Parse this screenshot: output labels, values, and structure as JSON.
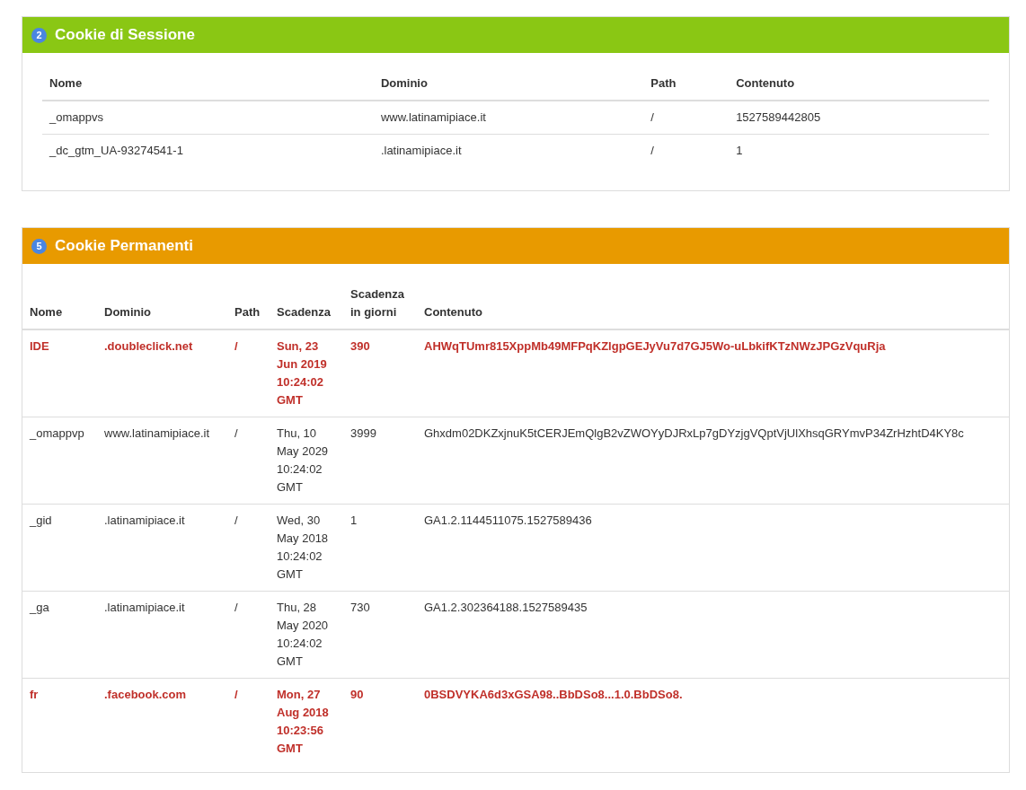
{
  "panels": [
    {
      "kind": "session",
      "badge": "2",
      "title": "Cookie di Sessione",
      "color": "#8ac714",
      "columns": [
        "Nome",
        "Dominio",
        "Path",
        "Contenuto"
      ],
      "rows": [
        {
          "flagged": false,
          "cells": [
            "_omappvs",
            "www.latinamipiace.it",
            "/",
            "1527589442805"
          ]
        },
        {
          "flagged": false,
          "cells": [
            "_dc_gtm_UA-93274541-1",
            ".latinamipiace.it",
            "/",
            "1"
          ]
        }
      ]
    },
    {
      "kind": "permanent",
      "badge": "5",
      "title": "Cookie Permanenti",
      "color": "#e89a00",
      "columns": [
        "Nome",
        "Dominio",
        "Path",
        "Scadenza",
        "Scadenza in giorni",
        "Contenuto"
      ],
      "rows": [
        {
          "flagged": true,
          "cells": [
            "IDE",
            ".doubleclick.net",
            "/",
            "Sun, 23 Jun 2019 10:24:02 GMT",
            "390",
            "AHWqTUmr815XppMb49MFPqKZlgpGEJyVu7d7GJ5Wo-uLbkifKTzNWzJPGzVquRja"
          ]
        },
        {
          "flagged": false,
          "cells": [
            "_omappvp",
            "www.latinamipiace.it",
            "/",
            "Thu, 10 May 2029 10:24:02 GMT",
            "3999",
            "Ghxdm02DKZxjnuK5tCERJEmQlgB2vZWOYyDJRxLp7gDYzjgVQptVjUlXhsqGRYmvP34ZrHzhtD4KY8c"
          ]
        },
        {
          "flagged": false,
          "cells": [
            "_gid",
            ".latinamipiace.it",
            "/",
            "Wed, 30 May 2018 10:24:02 GMT",
            "1",
            "GA1.2.1144511075.1527589436"
          ]
        },
        {
          "flagged": false,
          "cells": [
            "_ga",
            ".latinamipiace.it",
            "/",
            "Thu, 28 May 2020 10:24:02 GMT",
            "730",
            "GA1.2.302364188.1527589435"
          ]
        },
        {
          "flagged": true,
          "cells": [
            "fr",
            ".facebook.com",
            "/",
            "Mon, 27 Aug 2018 10:23:56 GMT",
            "90",
            "0BSDVYKA6d3xGSA98..BbDSo8...1.0.BbDSo8."
          ]
        }
      ]
    }
  ]
}
